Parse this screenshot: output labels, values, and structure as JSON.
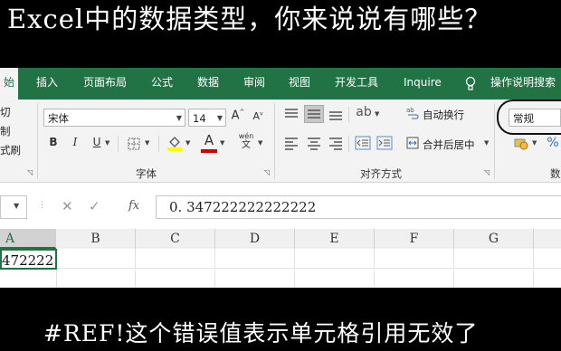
{
  "captions": {
    "top": "Excel中的数据类型，你来说说有哪些？",
    "bottom": "#REF!这个错误值表示单元格引用无效了"
  },
  "tabs": [
    {
      "label": "始"
    },
    {
      "label": "插入"
    },
    {
      "label": "页面布局"
    },
    {
      "label": "公式"
    },
    {
      "label": "数据"
    },
    {
      "label": "审阅"
    },
    {
      "label": "视图"
    },
    {
      "label": "开发工具"
    },
    {
      "label": "Inquire"
    },
    {
      "label": "操作说明搜索"
    }
  ],
  "clipboard": {
    "cut": "切",
    "copy": "制",
    "format_painter": "式刷"
  },
  "font": {
    "family": "宋体",
    "size": "14",
    "increase_label": "A",
    "decrease_label": "A",
    "bold": "B",
    "italic": "I",
    "underline": "U",
    "font_color_label": "A",
    "phonetic_label": "wén",
    "group_label": "字体"
  },
  "alignment": {
    "wrap_text": "自动换行",
    "merge_center": "合并后居中",
    "group_label": "对齐方式"
  },
  "number": {
    "format": "常规",
    "group_label": "数"
  },
  "formula_bar": {
    "fx": "fx",
    "value": "0. 347222222222222"
  },
  "columns": [
    "A",
    "B",
    "C",
    "D",
    "E",
    "F",
    "G"
  ],
  "cells": {
    "a1": "472222"
  },
  "colors": {
    "excel_green": "#217346",
    "font_color_bar": "#d00000",
    "highlight_bar": "#ffff00"
  }
}
